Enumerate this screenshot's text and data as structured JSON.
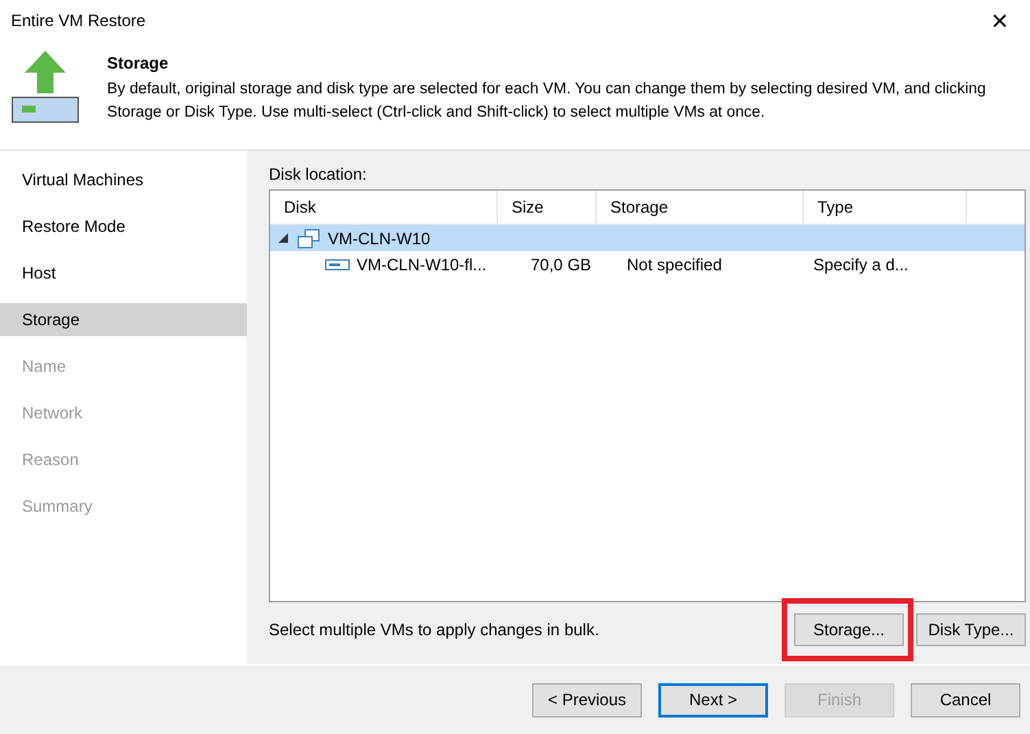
{
  "window": {
    "title": "Entire VM Restore",
    "close": "✕"
  },
  "header": {
    "title": "Storage",
    "description": "By default, original storage and disk type are selected for each VM. You can change them by selecting desired VM, and clicking Storage or Disk Type. Use multi-select (Ctrl-click and Shift-click) to select multiple VMs at once."
  },
  "sidebar": {
    "items": [
      {
        "label": "Virtual Machines",
        "selected": false,
        "disabled": false
      },
      {
        "label": "Restore Mode",
        "selected": false,
        "disabled": false
      },
      {
        "label": "Host",
        "selected": false,
        "disabled": false
      },
      {
        "label": "Storage",
        "selected": true,
        "disabled": false
      },
      {
        "label": "Name",
        "selected": false,
        "disabled": true
      },
      {
        "label": "Network",
        "selected": false,
        "disabled": true
      },
      {
        "label": "Reason",
        "selected": false,
        "disabled": true
      },
      {
        "label": "Summary",
        "selected": false,
        "disabled": true
      }
    ]
  },
  "disk_location": {
    "label": "Disk location:",
    "columns": [
      "Disk",
      "Size",
      "Storage",
      "Type"
    ],
    "rows": [
      {
        "kind": "vm",
        "disk": "VM-CLN-W10",
        "expanded": true,
        "selected": true,
        "children": [
          {
            "kind": "disk",
            "disk": "VM-CLN-W10-fl...",
            "size": "70,0 GB",
            "storage": "Not specified",
            "type": "Specify a d...",
            "selected": false
          }
        ]
      }
    ]
  },
  "hint": "Select multiple VMs to apply changes in bulk.",
  "panel_buttons": [
    {
      "label": "Storage...",
      "highlighted": true
    },
    {
      "label": "Disk Type..."
    }
  ],
  "footer_buttons": [
    {
      "label": "< Previous",
      "default": false,
      "disabled": false
    },
    {
      "label": "Next >",
      "default": true,
      "disabled": false
    },
    {
      "label": "Finish",
      "default": false,
      "disabled": true
    },
    {
      "label": "Cancel",
      "default": false,
      "disabled": false
    }
  ]
}
